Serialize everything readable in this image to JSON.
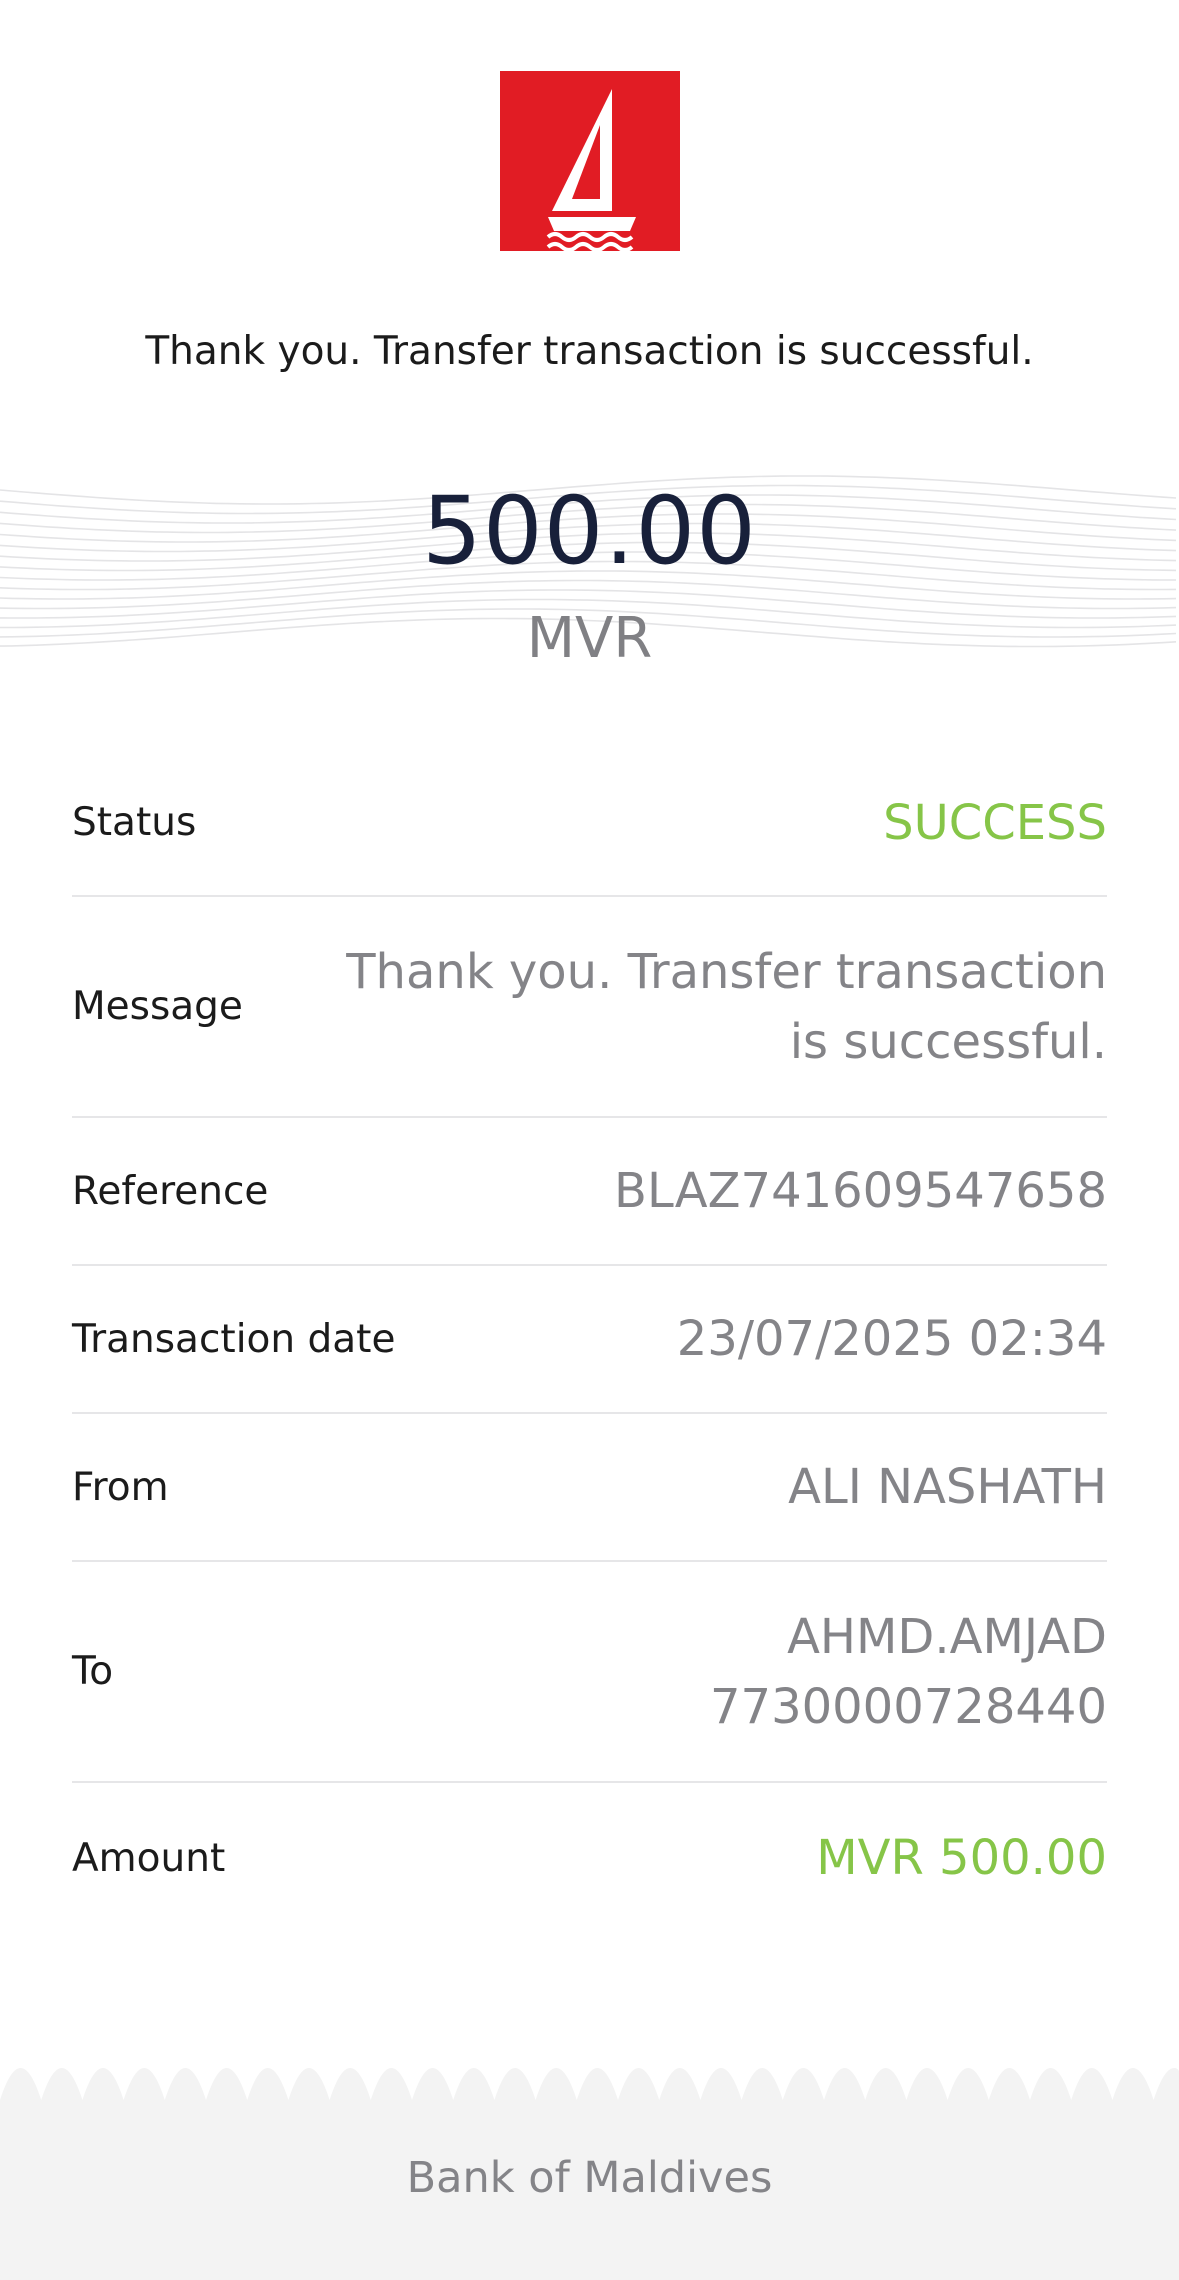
{
  "logo": {
    "icon": "sailboat-icon",
    "background_color": "#e11c24"
  },
  "headline": "Thank you. Transfer transaction is successful.",
  "amount": {
    "value": "500.00",
    "currency": "MVR"
  },
  "details": {
    "status": {
      "label": "Status",
      "value": "SUCCESS"
    },
    "message": {
      "label": "Message",
      "value_line1": "Thank you. Transfer transaction",
      "value_line2": "is successful."
    },
    "reference": {
      "label": "Reference",
      "value": "BLAZ741609547658"
    },
    "transaction_date": {
      "label": "Transaction date",
      "value": "23/07/2025 02:34"
    },
    "from": {
      "label": "From",
      "value": "ALI NASHATH"
    },
    "to": {
      "label": "To",
      "value_line1": "AHMD.AMJAD",
      "value_line2": "7730000728440"
    },
    "amount": {
      "label": "Amount",
      "value": "MVR 500.00"
    }
  },
  "footer": {
    "text": "Bank of Maldives"
  },
  "colors": {
    "accent_green": "#86c548",
    "brand_red": "#e11c24",
    "amount_navy": "#18203a"
  }
}
